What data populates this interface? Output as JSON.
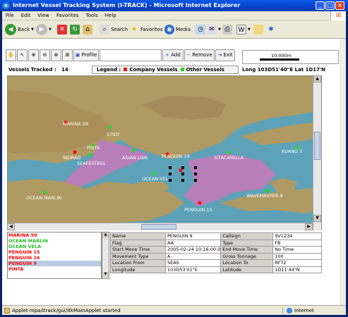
{
  "window": {
    "title": "Internet Vessel Tracking System (I-TRACK) - Microsoft Internet Explorer"
  },
  "menu": [
    "File",
    "Edit",
    "View",
    "Favorites",
    "Tools",
    "Help"
  ],
  "toolbar": {
    "back": "Back",
    "search": "Search",
    "favorites": "Favorites",
    "media": "Media"
  },
  "app": {
    "profile": "Profile",
    "add": "Add",
    "remove": "Remove",
    "exit": "Exit",
    "scale": "10,000m",
    "vessels_label": "Vessels Tracked :",
    "vessels_count": "14",
    "legend_label": "Legend :",
    "legend_company": "Company Vessels",
    "legend_other": "Other Vessels",
    "longlat": "Long 103D51'40\"E  Lat 1D17'N",
    "colors": {
      "company": "#ff0000",
      "other": "#22dd22",
      "water": "#5da2b8",
      "land": "#b09a64",
      "zone": "#b87fba"
    }
  },
  "map_labels": [
    {
      "name": "MARINA 99",
      "type": "company"
    },
    {
      "name": "PINTA",
      "type": "company"
    },
    {
      "name": "STIDY",
      "type": "other"
    },
    {
      "name": "INDRAD",
      "type": "other"
    },
    {
      "name": "SEAFESTREL",
      "type": "other"
    },
    {
      "name": "ASIAN LINK",
      "type": "other"
    },
    {
      "name": "PENGUIN 16",
      "type": "company"
    },
    {
      "name": "OCEAN VEL",
      "type": "other"
    },
    {
      "name": "SITACAMILLA",
      "type": "other"
    },
    {
      "name": "KUANG 3",
      "type": "other"
    },
    {
      "name": "OCEAN MARLIN",
      "type": "other"
    },
    {
      "name": "WAVEMASTER 8",
      "type": "other"
    },
    {
      "name": "PENGUIN 15",
      "type": "company"
    }
  ],
  "vessel_list": [
    {
      "name": "MARINA 99",
      "type": "company"
    },
    {
      "name": "OCEAN MARLIN",
      "type": "other"
    },
    {
      "name": "OCEAN VELA",
      "type": "other"
    },
    {
      "name": "PENGUIN 15",
      "type": "company"
    },
    {
      "name": "PENGUIN 16",
      "type": "company"
    },
    {
      "name": "PENGUIN 9",
      "type": "company",
      "selected": true
    },
    {
      "name": "PINTA",
      "type": "company"
    }
  ],
  "details": [
    [
      "Name",
      "PENGUIN 9",
      "Callsign",
      "9V1234"
    ],
    [
      "Flag",
      "AA",
      "Type",
      "FB"
    ],
    [
      "Start Move Time",
      "2005-02-24 10:16:00.0",
      "End Move Time",
      "No Time"
    ],
    [
      "Movement Type",
      "A",
      "Gross Tonnage",
      "100"
    ],
    [
      "Location From",
      "SEAS",
      "Location To",
      "RFT2"
    ],
    [
      "Longitude",
      "103D53'01\"E",
      "Latitude",
      "1D11'44\"N"
    ]
  ],
  "status": {
    "text": "Applet mpa/itrack/gui/ItkMainApplet started",
    "zone": "Internet"
  }
}
